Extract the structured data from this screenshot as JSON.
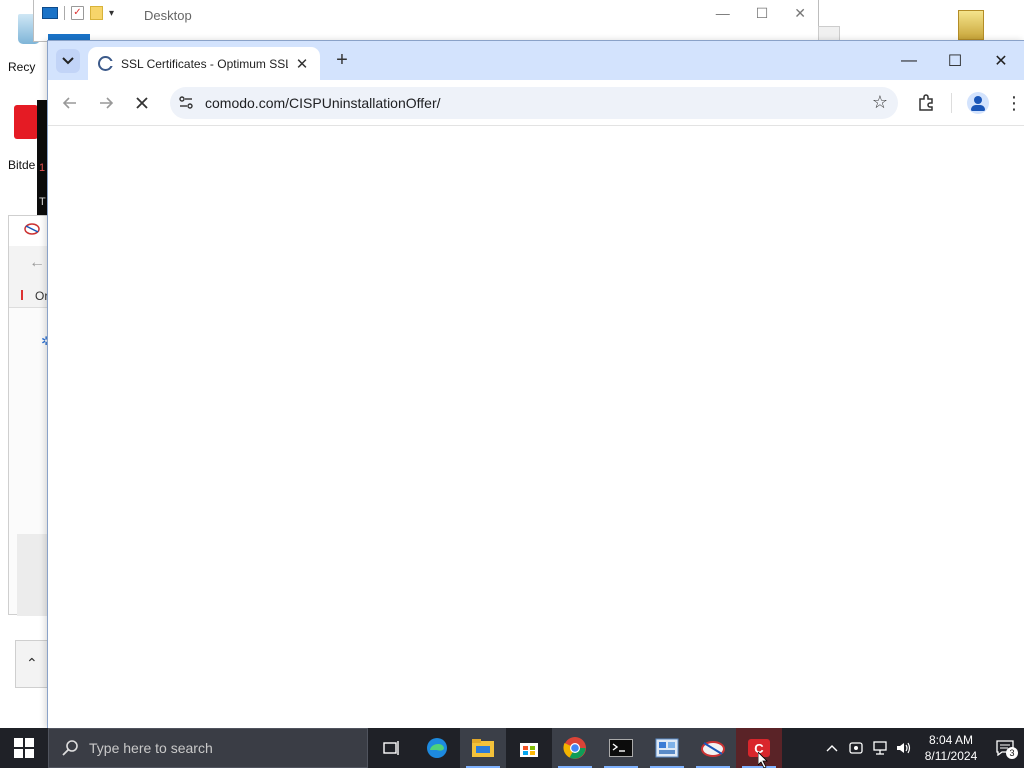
{
  "desktop": {
    "recycle_label": "Recy",
    "bitdefender_label": "Bitde",
    "bg_window_text": "Or",
    "terminal_fragment_1": "1",
    "terminal_fragment_2": "T"
  },
  "explorer": {
    "title": "Desktop"
  },
  "browser": {
    "tab_title": "SSL Certificates - Optimum SSL",
    "url": "comodo.com/CISPUninstallationOffer/",
    "accent": "#d3e3fd"
  },
  "taskbar": {
    "search_placeholder": "Type here to search",
    "time": "8:04 AM",
    "date": "8/11/2024",
    "notification_count": "3",
    "bg_color": "#1f2127"
  }
}
